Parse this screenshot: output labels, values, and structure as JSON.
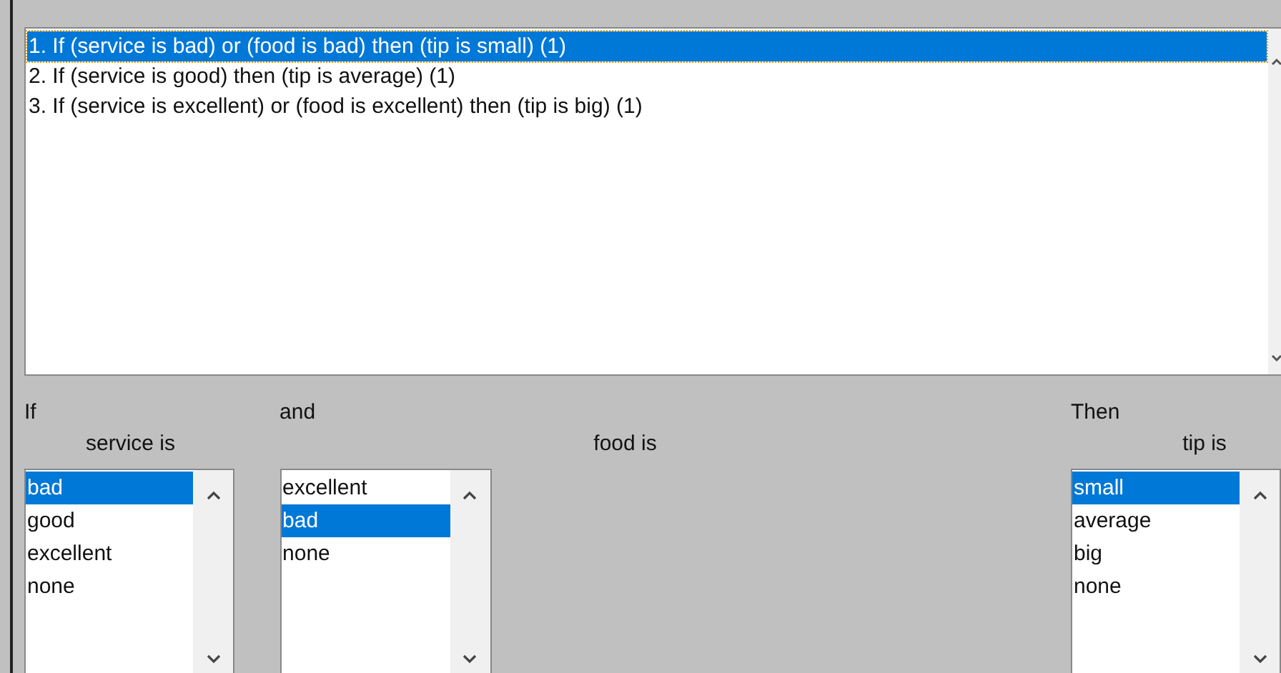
{
  "rules": [
    {
      "text": "1. If (service is bad) or (food is bad) then (tip is small) (1)",
      "selected": true
    },
    {
      "text": "2. If (service is good) then (tip is average) (1)",
      "selected": false
    },
    {
      "text": "3. If (service is excellent) or (food is excellent) then (tip is big) (1)",
      "selected": false
    }
  ],
  "groups": [
    {
      "heading": "If",
      "label": "service is",
      "options": [
        {
          "text": "bad",
          "selected": true
        },
        {
          "text": "good",
          "selected": false
        },
        {
          "text": "excellent",
          "selected": false
        },
        {
          "text": "none",
          "selected": false
        }
      ]
    },
    {
      "heading": "and",
      "label": "food is",
      "options": [
        {
          "text": "excellent",
          "selected": false
        },
        {
          "text": "bad",
          "selected": true
        },
        {
          "text": "none",
          "selected": false
        }
      ]
    },
    {
      "heading": "Then",
      "label": "tip is",
      "options": [
        {
          "text": "small",
          "selected": true
        },
        {
          "text": "average",
          "selected": false
        },
        {
          "text": "big",
          "selected": false
        },
        {
          "text": "none",
          "selected": false
        }
      ]
    }
  ]
}
